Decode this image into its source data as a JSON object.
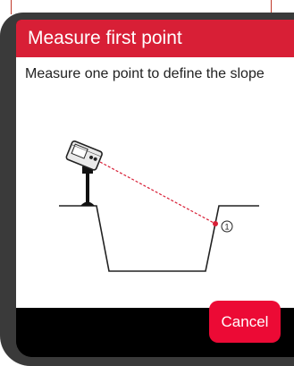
{
  "dialog": {
    "title": "Measure first point",
    "message": "Measure one point to define the slope",
    "cancel_label": "Cancel"
  },
  "illustration": {
    "point_label": "1"
  },
  "colors": {
    "title_bar": "#d81f36",
    "cancel_button": "#ec0a35",
    "measure_line": "#d81f36"
  }
}
